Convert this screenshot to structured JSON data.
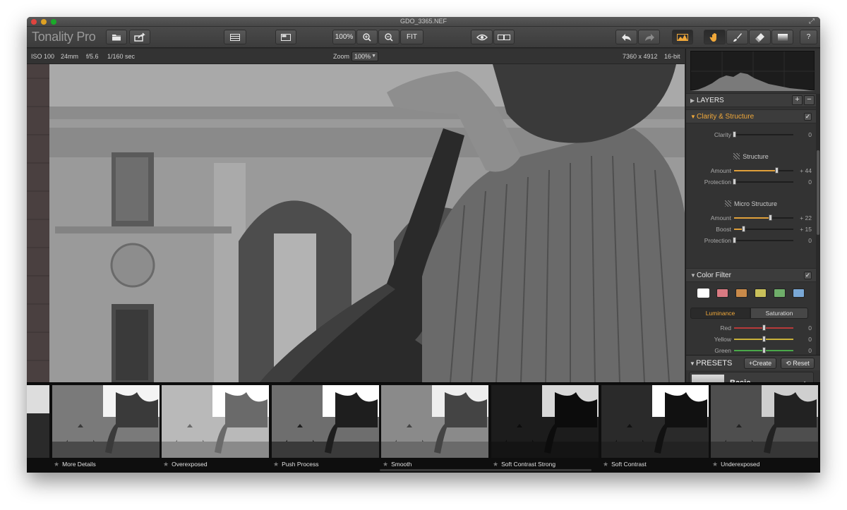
{
  "window": {
    "title": "GDO_3365.NEF"
  },
  "toolbar": {
    "brand": "Tonality Pro",
    "open_icon": "folder-icon",
    "share_icon": "share-icon",
    "zoom_100_label": "100%",
    "fit_label": "FIT",
    "help_label": "?"
  },
  "infobar": {
    "iso": "ISO 100",
    "focal": "24mm",
    "aperture": "f/5.6",
    "shutter": "1/160 sec",
    "zoom_label": "Zoom",
    "zoom_value": "100%",
    "dimensions": "7360 x 4912",
    "bitdepth": "16-bit"
  },
  "panel": {
    "layers_label": "LAYERS",
    "clarity_section": {
      "title": "Clarity & Structure",
      "checked": "✓",
      "clarity": {
        "label": "Clarity",
        "value": "0",
        "level": 0
      },
      "structure_title": "Structure",
      "structure_amount": {
        "label": "Amount",
        "value": "+ 44",
        "level": 0.72
      },
      "structure_protection": {
        "label": "Protection",
        "value": "0",
        "level": 0
      },
      "micro_title": "Micro Structure",
      "micro_amount": {
        "label": "Amount",
        "value": "+ 22",
        "level": 0.61
      },
      "micro_boost": {
        "label": "Boost",
        "value": "+ 15",
        "level": 0.15
      },
      "micro_protection": {
        "label": "Protection",
        "value": "0",
        "level": 0
      }
    },
    "color_filter": {
      "title": "Color Filter",
      "checked": "✓",
      "swatch_colors": [
        "#ffffff",
        "#d97a82",
        "#c98a4a",
        "#c9c05a",
        "#6fae6a",
        "#7aa8d6"
      ],
      "luminance_label": "Luminance",
      "saturation_label": "Saturation",
      "red": {
        "label": "Red",
        "value": "0",
        "level": 0.5
      },
      "yellow": {
        "label": "Yellow",
        "value": "0",
        "level": 0.5
      },
      "green": {
        "label": "Green",
        "value": "0",
        "level": 0.5
      }
    },
    "presets": {
      "title": "PRESETS",
      "create_label": "+Create",
      "reset_label": "Reset",
      "current": "Basic"
    }
  },
  "filmstrip": {
    "items": [
      {
        "label": "More Details"
      },
      {
        "label": "Overexposed"
      },
      {
        "label": "Push Process"
      },
      {
        "label": "Smooth"
      },
      {
        "label": "Soft Contrast Strong"
      },
      {
        "label": "Soft Contrast"
      },
      {
        "label": "Underexposed"
      }
    ]
  },
  "colors": {
    "accent": "#f0a83a",
    "clarity_fill": "#e0a03a",
    "red_track": "#b83a3a",
    "yellow_track": "#c9b23a",
    "green_track": "#4aa84a"
  }
}
